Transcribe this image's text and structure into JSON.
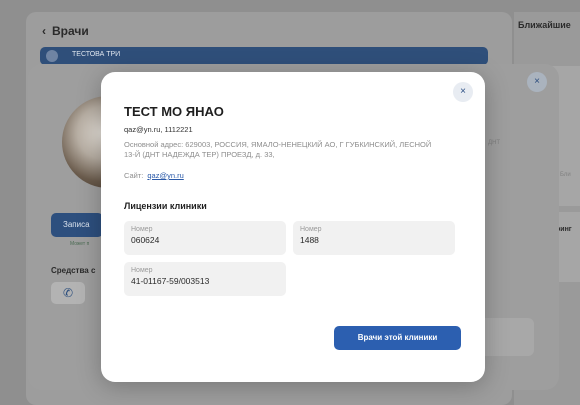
{
  "page": {
    "back_label": "Врачи",
    "clinic_bar_text": "ТЕСТОВА ТРИ",
    "right_title": "Ближайшие",
    "right_text1": "Бли",
    "right_text2": "ринг"
  },
  "doctor_dialog": {
    "book_button": "Записа",
    "small_note": "Может п",
    "means_label": "Средства с",
    "side_text": "ДНТ"
  },
  "clinic_modal": {
    "title": "ТЕСТ МО ЯНАО",
    "contact": "qaz@yn.ru, 1112221",
    "address": "Основной адрес: 629003, РОССИЯ, ЯМАЛО-НЕНЕЦКИЙ АО, Г ГУБКИНСКИЙ, ЛЕСНОЙ 13-Й (ДНТ НАДЕЖДА ТЕР) ПРОЕЗД, д. 33,",
    "site_label": "Сайт:",
    "site_link": "qaz@yn.ru",
    "licenses_title": "Лицензии клиники",
    "licenses": [
      {
        "label": "Номер",
        "value": "060624"
      },
      {
        "label": "Номер",
        "value": "1488"
      },
      {
        "label": "Номер",
        "value": "41-01167-59/003513"
      }
    ],
    "doctors_button": "Врачи этой клиники"
  },
  "icons": {
    "close": "×",
    "back_chevron": "‹",
    "phone": "✆"
  }
}
